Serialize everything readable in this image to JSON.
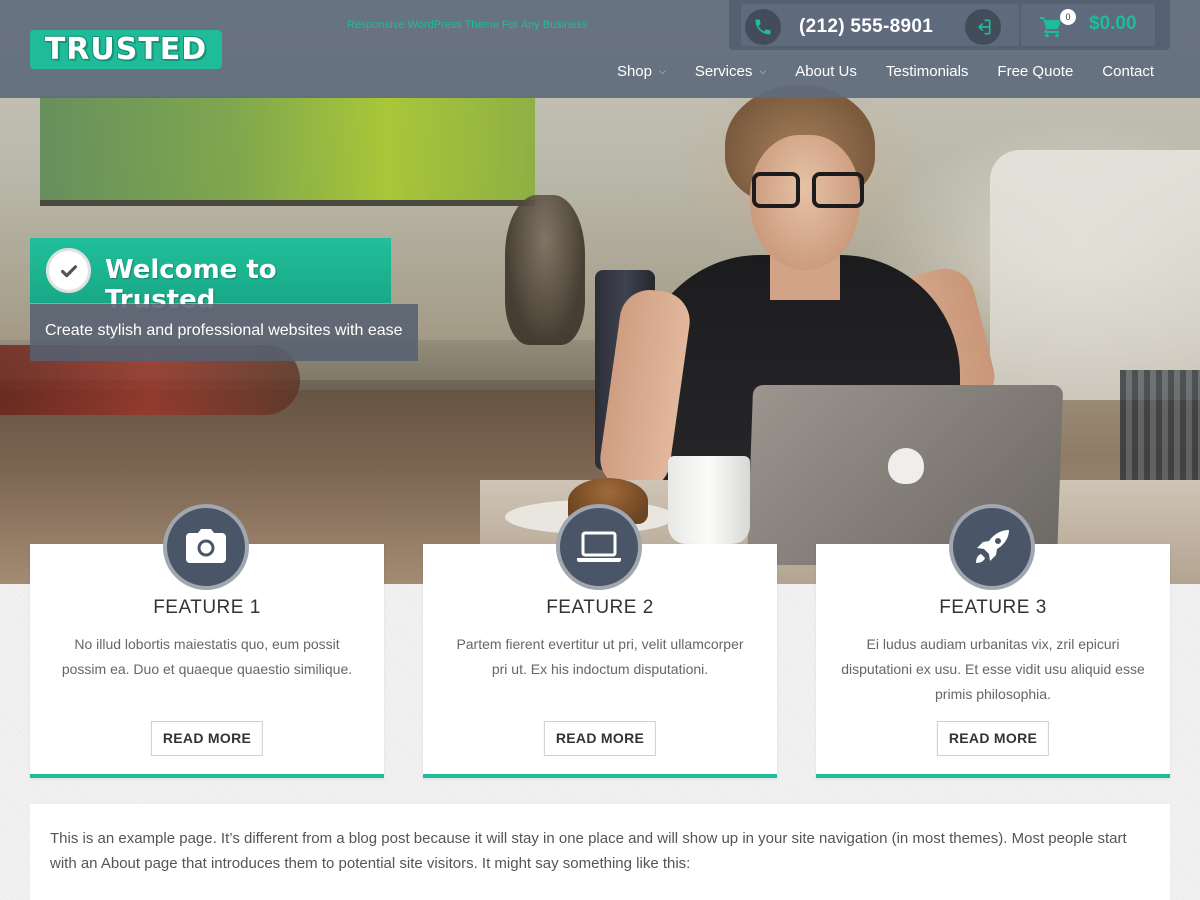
{
  "site": {
    "logo_text": "TRUSTED",
    "tagline": "Responsive WordPress Theme For Any Business"
  },
  "topbar": {
    "phone": "(212) 555-8901",
    "cart_count": "0",
    "cart_total": "$0.00",
    "icons": [
      "phone-icon",
      "sign-in-icon",
      "cart-icon"
    ]
  },
  "nav": {
    "items": [
      {
        "label": "Shop",
        "has_dropdown": true
      },
      {
        "label": "Services",
        "has_dropdown": true
      },
      {
        "label": "About Us",
        "has_dropdown": false
      },
      {
        "label": "Testimonials",
        "has_dropdown": false
      },
      {
        "label": "Free Quote",
        "has_dropdown": false
      },
      {
        "label": "Contact",
        "has_dropdown": false
      }
    ]
  },
  "welcome": {
    "title": "Welcome to Trusted",
    "subtitle": "Create stylish and professional websites with ease",
    "icon": "check-icon"
  },
  "features": [
    {
      "icon": "camera-icon",
      "title": "FEATURE 1",
      "text": "No illud lobortis maiestatis quo, eum possit possim ea. Duo et quaeque quaestio similique.",
      "button": "READ MORE"
    },
    {
      "icon": "laptop-icon",
      "title": "FEATURE 2",
      "text": "Partem fierent evertitur ut pri, velit ullamcorper pri ut. Ex his indoctum disputationi.",
      "button": "READ MORE"
    },
    {
      "icon": "rocket-icon",
      "title": "FEATURE 3",
      "text": "Ei ludus audiam urbanitas vix, zril epicuri disputationi ex usu. Et esse vidit usu aliquid esse primis philosophia.",
      "button": "READ MORE"
    }
  ],
  "content": {
    "text": "This is an example page. It’s different from a blog post because it will stay in one place and will show up in your site navigation (in most themes). Most people start with an About page that introduces them to potential site visitors. It might say something like this:"
  },
  "colors": {
    "accent": "#1ebc98",
    "header_bg": "#5f6b7d",
    "icon_circle": "#4a5568"
  }
}
